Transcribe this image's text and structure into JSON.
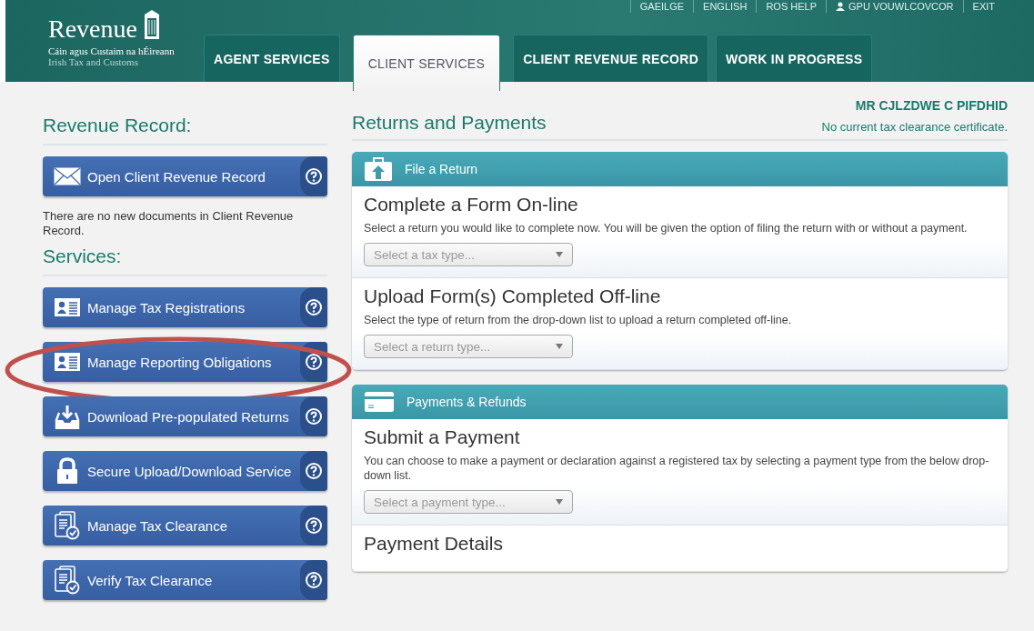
{
  "header": {
    "logo": {
      "name": "Revenue",
      "irish": "Cáin agus Custaim na hÉireann",
      "english": "Irish Tax and Customs"
    },
    "top_links": [
      {
        "label": "GAEILGE",
        "kind": "link"
      },
      {
        "label": "ENGLISH",
        "kind": "link"
      },
      {
        "label": "ROS HELP",
        "kind": "link"
      },
      {
        "label": "GPU VOUWLCOVCOR",
        "kind": "user"
      },
      {
        "label": "EXIT",
        "kind": "link"
      }
    ],
    "tabs": [
      {
        "label": "AGENT SERVICES",
        "selected": false
      },
      {
        "label": "CLIENT SERVICES",
        "selected": true
      },
      {
        "label": "CLIENT REVENUE RECORD",
        "selected": false
      },
      {
        "label": "WORK IN PROGRESS",
        "selected": false
      }
    ]
  },
  "sidebar": {
    "record_heading": "Revenue Record:",
    "record_button": {
      "label": "Open Client Revenue Record",
      "kind": "envelope"
    },
    "record_note": "There are no new documents in Client Revenue Record.",
    "services_heading": "Services:",
    "services": [
      {
        "label": "Manage Tax Registrations",
        "kind": "registration",
        "highlighted": false
      },
      {
        "label": "Manage Reporting Obligations",
        "kind": "registration",
        "highlighted": true
      },
      {
        "label": "Download Pre-populated Returns",
        "kind": "download",
        "highlighted": false
      },
      {
        "label": "Secure Upload/Download Service",
        "kind": "secure",
        "highlighted": false
      },
      {
        "label": "Manage Tax Clearance",
        "kind": "clearance",
        "highlighted": false
      },
      {
        "label": "Verify Tax Clearance",
        "kind": "clearance",
        "highlighted": false
      }
    ]
  },
  "main": {
    "heading": "Returns and Payments",
    "client_name": "MR CJLZDWE C PIFDHID",
    "clearance_status": "No current tax clearance certificate.",
    "panels": [
      {
        "title": "File a Return",
        "kind": "returns",
        "sections": [
          {
            "title": "Complete a Form On-line",
            "description": "Select a return you would like to complete now. You will be given the option of filing the return with or without a payment.",
            "select": {
              "placeholder": "Select a tax type..."
            }
          },
          {
            "title": "Upload Form(s) Completed Off-line",
            "description": "Select the type of return from the drop-down list to upload a return completed off-line.",
            "select": {
              "placeholder": "Select a return type..."
            }
          }
        ]
      },
      {
        "title": "Payments & Refunds",
        "kind": "payments",
        "sections": [
          {
            "title": "Submit a Payment",
            "description": "You can choose to make a payment or declaration against a registered tax by selecting a payment type from the below drop-down list.",
            "select": {
              "placeholder": "Select a payment type..."
            }
          },
          {
            "title": "Payment Details"
          }
        ]
      }
    ]
  }
}
